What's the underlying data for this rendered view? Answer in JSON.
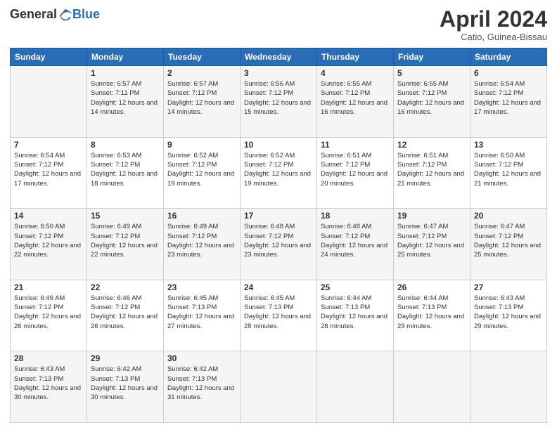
{
  "logo": {
    "general": "General",
    "blue": "Blue"
  },
  "header": {
    "month": "April 2024",
    "location": "Catio, Guinea-Bissau"
  },
  "weekdays": [
    "Sunday",
    "Monday",
    "Tuesday",
    "Wednesday",
    "Thursday",
    "Friday",
    "Saturday"
  ],
  "weeks": [
    [
      {
        "day": "",
        "sunrise": "",
        "sunset": "",
        "daylight": ""
      },
      {
        "day": "1",
        "sunrise": "Sunrise: 6:57 AM",
        "sunset": "Sunset: 7:11 PM",
        "daylight": "Daylight: 12 hours and 14 minutes."
      },
      {
        "day": "2",
        "sunrise": "Sunrise: 6:57 AM",
        "sunset": "Sunset: 7:12 PM",
        "daylight": "Daylight: 12 hours and 14 minutes."
      },
      {
        "day": "3",
        "sunrise": "Sunrise: 6:56 AM",
        "sunset": "Sunset: 7:12 PM",
        "daylight": "Daylight: 12 hours and 15 minutes."
      },
      {
        "day": "4",
        "sunrise": "Sunrise: 6:55 AM",
        "sunset": "Sunset: 7:12 PM",
        "daylight": "Daylight: 12 hours and 16 minutes."
      },
      {
        "day": "5",
        "sunrise": "Sunrise: 6:55 AM",
        "sunset": "Sunset: 7:12 PM",
        "daylight": "Daylight: 12 hours and 16 minutes."
      },
      {
        "day": "6",
        "sunrise": "Sunrise: 6:54 AM",
        "sunset": "Sunset: 7:12 PM",
        "daylight": "Daylight: 12 hours and 17 minutes."
      }
    ],
    [
      {
        "day": "7",
        "sunrise": "Sunrise: 6:54 AM",
        "sunset": "Sunset: 7:12 PM",
        "daylight": "Daylight: 12 hours and 17 minutes."
      },
      {
        "day": "8",
        "sunrise": "Sunrise: 6:53 AM",
        "sunset": "Sunset: 7:12 PM",
        "daylight": "Daylight: 12 hours and 18 minutes."
      },
      {
        "day": "9",
        "sunrise": "Sunrise: 6:52 AM",
        "sunset": "Sunset: 7:12 PM",
        "daylight": "Daylight: 12 hours and 19 minutes."
      },
      {
        "day": "10",
        "sunrise": "Sunrise: 6:52 AM",
        "sunset": "Sunset: 7:12 PM",
        "daylight": "Daylight: 12 hours and 19 minutes."
      },
      {
        "day": "11",
        "sunrise": "Sunrise: 6:51 AM",
        "sunset": "Sunset: 7:12 PM",
        "daylight": "Daylight: 12 hours and 20 minutes."
      },
      {
        "day": "12",
        "sunrise": "Sunrise: 6:51 AM",
        "sunset": "Sunset: 7:12 PM",
        "daylight": "Daylight: 12 hours and 21 minutes."
      },
      {
        "day": "13",
        "sunrise": "Sunrise: 6:50 AM",
        "sunset": "Sunset: 7:12 PM",
        "daylight": "Daylight: 12 hours and 21 minutes."
      }
    ],
    [
      {
        "day": "14",
        "sunrise": "Sunrise: 6:50 AM",
        "sunset": "Sunset: 7:12 PM",
        "daylight": "Daylight: 12 hours and 22 minutes."
      },
      {
        "day": "15",
        "sunrise": "Sunrise: 6:49 AM",
        "sunset": "Sunset: 7:12 PM",
        "daylight": "Daylight: 12 hours and 22 minutes."
      },
      {
        "day": "16",
        "sunrise": "Sunrise: 6:49 AM",
        "sunset": "Sunset: 7:12 PM",
        "daylight": "Daylight: 12 hours and 23 minutes."
      },
      {
        "day": "17",
        "sunrise": "Sunrise: 6:48 AM",
        "sunset": "Sunset: 7:12 PM",
        "daylight": "Daylight: 12 hours and 23 minutes."
      },
      {
        "day": "18",
        "sunrise": "Sunrise: 6:48 AM",
        "sunset": "Sunset: 7:12 PM",
        "daylight": "Daylight: 12 hours and 24 minutes."
      },
      {
        "day": "19",
        "sunrise": "Sunrise: 6:47 AM",
        "sunset": "Sunset: 7:12 PM",
        "daylight": "Daylight: 12 hours and 25 minutes."
      },
      {
        "day": "20",
        "sunrise": "Sunrise: 6:47 AM",
        "sunset": "Sunset: 7:12 PM",
        "daylight": "Daylight: 12 hours and 25 minutes."
      }
    ],
    [
      {
        "day": "21",
        "sunrise": "Sunrise: 6:46 AM",
        "sunset": "Sunset: 7:12 PM",
        "daylight": "Daylight: 12 hours and 26 minutes."
      },
      {
        "day": "22",
        "sunrise": "Sunrise: 6:46 AM",
        "sunset": "Sunset: 7:12 PM",
        "daylight": "Daylight: 12 hours and 26 minutes."
      },
      {
        "day": "23",
        "sunrise": "Sunrise: 6:45 AM",
        "sunset": "Sunset: 7:13 PM",
        "daylight": "Daylight: 12 hours and 27 minutes."
      },
      {
        "day": "24",
        "sunrise": "Sunrise: 6:45 AM",
        "sunset": "Sunset: 7:13 PM",
        "daylight": "Daylight: 12 hours and 28 minutes."
      },
      {
        "day": "25",
        "sunrise": "Sunrise: 6:44 AM",
        "sunset": "Sunset: 7:13 PM",
        "daylight": "Daylight: 12 hours and 28 minutes."
      },
      {
        "day": "26",
        "sunrise": "Sunrise: 6:44 AM",
        "sunset": "Sunset: 7:13 PM",
        "daylight": "Daylight: 12 hours and 29 minutes."
      },
      {
        "day": "27",
        "sunrise": "Sunrise: 6:43 AM",
        "sunset": "Sunset: 7:13 PM",
        "daylight": "Daylight: 12 hours and 29 minutes."
      }
    ],
    [
      {
        "day": "28",
        "sunrise": "Sunrise: 6:43 AM",
        "sunset": "Sunset: 7:13 PM",
        "daylight": "Daylight: 12 hours and 30 minutes."
      },
      {
        "day": "29",
        "sunrise": "Sunrise: 6:42 AM",
        "sunset": "Sunset: 7:13 PM",
        "daylight": "Daylight: 12 hours and 30 minutes."
      },
      {
        "day": "30",
        "sunrise": "Sunrise: 6:42 AM",
        "sunset": "Sunset: 7:13 PM",
        "daylight": "Daylight: 12 hours and 31 minutes."
      },
      {
        "day": "",
        "sunrise": "",
        "sunset": "",
        "daylight": ""
      },
      {
        "day": "",
        "sunrise": "",
        "sunset": "",
        "daylight": ""
      },
      {
        "day": "",
        "sunrise": "",
        "sunset": "",
        "daylight": ""
      },
      {
        "day": "",
        "sunrise": "",
        "sunset": "",
        "daylight": ""
      }
    ]
  ]
}
